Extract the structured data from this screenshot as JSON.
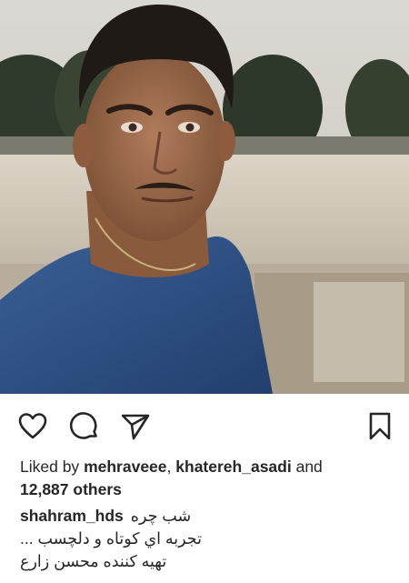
{
  "post": {
    "image": {
      "alt": ""
    },
    "actions": [
      {
        "name": "like-heart-icon",
        "label": ""
      },
      {
        "name": "comment-bubble-icon",
        "label": ""
      },
      {
        "name": "share-send-icon",
        "label": ""
      },
      {
        "name": "save-bookmark-icon",
        "label": ""
      }
    ],
    "likes": {
      "prefix": "Liked by",
      "user1": "mehraveee",
      "separator": ",",
      "user2": "khatereh_asadi",
      "and": "and",
      "count": "12,887 others"
    },
    "caption": {
      "username": "shahram_hds",
      "line1": "شب چره",
      "line2": "تجربه اي كوتاه و دلچسب ...",
      "line3": "تهيه كننده محسن زارع"
    }
  },
  "colors": {
    "text": "#262626",
    "background": "#ffffff"
  }
}
